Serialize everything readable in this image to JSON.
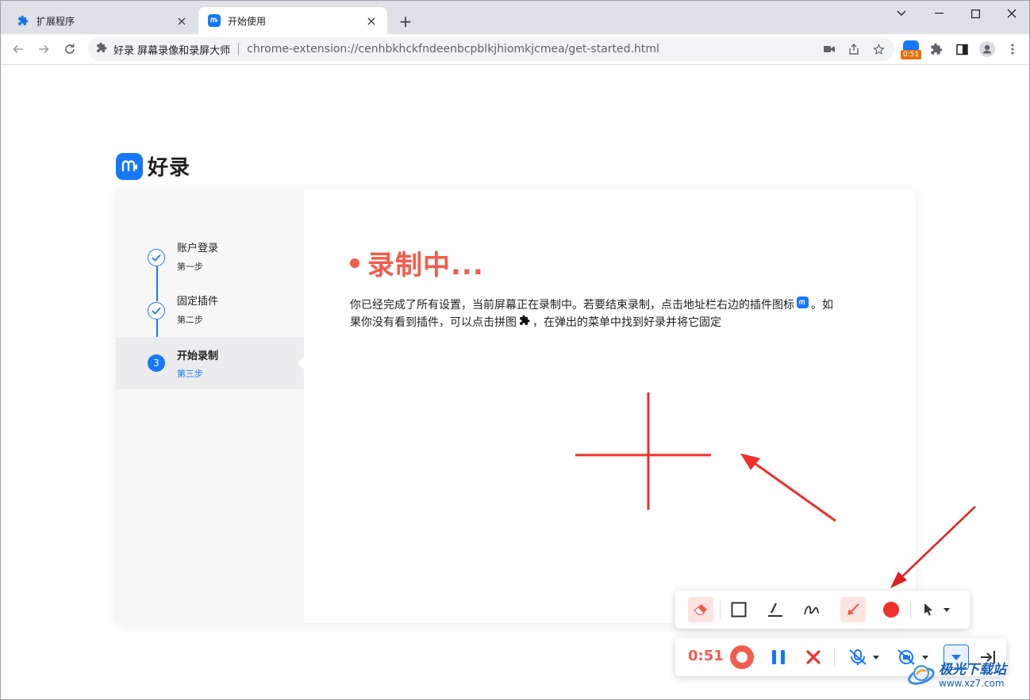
{
  "tabs": [
    {
      "title": "扩展程序",
      "icon": "puzzle-icon"
    },
    {
      "title": "开始使用",
      "icon": "haolu-icon"
    }
  ],
  "address_bar": {
    "site_name": "好录 屏幕录像和录屏大师",
    "url": "chrome-extension://cenhbkhckfndeenbcpblkjhiomkjcmea/get-started.html"
  },
  "extension_badge": {
    "time": "0:51"
  },
  "brand": {
    "name": "好录"
  },
  "steps": [
    {
      "label": "账户登录",
      "sub": "第一步",
      "state": "done"
    },
    {
      "label": "固定插件",
      "sub": "第二步",
      "state": "done"
    },
    {
      "label": "开始录制",
      "sub": "第三步",
      "state": "current",
      "number": "3"
    }
  ],
  "main": {
    "title": "录制中...",
    "desc_part1": "你已经完成了所有设置，当前屏幕正在录制中。若要结束录制，点击地址栏右边的插件图标",
    "desc_part2": "。如果你没有看到插件，可以点击拼图",
    "desc_part3": "，在弹出的菜单中找到好录并将它固定"
  },
  "recorder": {
    "timer": "0:51",
    "accent_color": "#f25c4c",
    "tools": [
      "eraser-icon",
      "rectangle-icon",
      "pen-icon",
      "freehand-icon",
      "arrow-tool-icon",
      "color-red-icon",
      "cursor-icon"
    ],
    "controls": [
      "record-icon",
      "pause-icon",
      "cancel-icon",
      "mic-off-icon",
      "camera-off-icon",
      "collapse-icon",
      "dock-right-icon"
    ]
  },
  "watermark": {
    "text": "极光下载站",
    "url": "www.xz7.com"
  }
}
